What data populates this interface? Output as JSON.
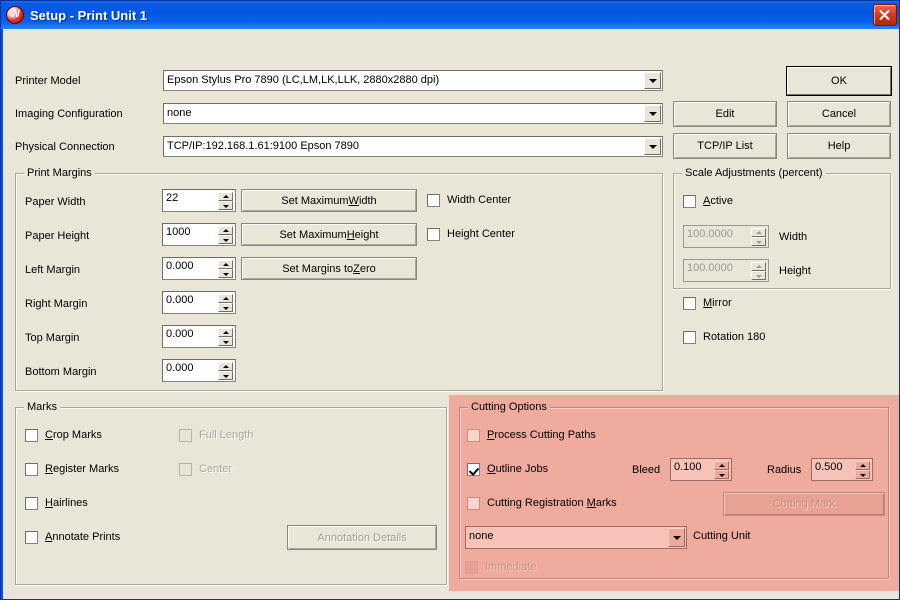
{
  "window": {
    "title": "Setup - Print Unit 1",
    "app_icon": "w-logo-icon",
    "close_label": "×"
  },
  "top_fields": [
    {
      "label": "Printer Model",
      "value": "Epson  Stylus Pro 7890  (LC,LM,LK,LLK, 2880x2880 dpi)"
    },
    {
      "label": "Imaging Configuration",
      "value": "none"
    },
    {
      "label": "Physical Connection",
      "value": "TCP/IP:192.168.1.61:9100 Epson 7890"
    }
  ],
  "side_buttons": {
    "ok": "OK",
    "cancel": "Cancel",
    "help": "Help",
    "edit": "Edit",
    "tcpip_list": "TCP/IP List"
  },
  "print_margins": {
    "title": "Print Margins",
    "rows": [
      {
        "label": "Paper Width",
        "value": "22"
      },
      {
        "label": "Paper Height",
        "value": "1000"
      },
      {
        "label": "Left Margin",
        "value": "0.000"
      },
      {
        "label": "Right Margin",
        "value": "0.000"
      },
      {
        "label": "Top Margin",
        "value": "0.000"
      },
      {
        "label": "Bottom Margin",
        "value": "0.000"
      }
    ],
    "buttons": {
      "set_max_width": {
        "pre": "Set Maximum ",
        "accel": "W",
        "post": "idth"
      },
      "set_max_height": {
        "pre": "Set Maximum ",
        "accel": "H",
        "post": "eight"
      },
      "set_margins_zero": {
        "pre": "Set Margins to ",
        "accel": "Z",
        "post": "ero"
      }
    },
    "checks": [
      {
        "label": "Width Center",
        "checked": false
      },
      {
        "label": "Height Center",
        "checked": false
      }
    ]
  },
  "scale_adjustments": {
    "title": "Scale Adjustments (percent)",
    "active": {
      "pre": "",
      "accel": "A",
      "post": "ctive",
      "checked": false
    },
    "width": {
      "value": "100.0000",
      "label": "Width",
      "disabled": true
    },
    "height": {
      "value": "100.0000",
      "label": "Height",
      "disabled": true
    },
    "mirror": {
      "pre": "",
      "accel": "M",
      "post": "irror",
      "checked": false
    },
    "rotation": {
      "label": "Rotation  180",
      "checked": false
    }
  },
  "marks": {
    "title": "Marks",
    "items": [
      {
        "pre": "",
        "accel": "C",
        "post": "rop Marks",
        "checked": false,
        "disabled": false
      },
      {
        "pre": "",
        "accel": "R",
        "post": "egister Marks",
        "checked": false,
        "disabled": false
      },
      {
        "pre": "",
        "accel": "H",
        "post": "airlines",
        "checked": false,
        "disabled": false
      },
      {
        "pre": "",
        "accel": "A",
        "post": "nnotate Prints",
        "checked": false,
        "disabled": false
      }
    ],
    "sub_items": [
      {
        "label": "Full Length",
        "checked": false,
        "disabled": true
      },
      {
        "label": "Center",
        "checked": false,
        "disabled": true
      }
    ],
    "annotation_button": "Annotation Details"
  },
  "cutting_options": {
    "title": "Cutting Options",
    "panel_color": "#EFAB9D",
    "process_cutting_paths": {
      "pre": "",
      "accel": "P",
      "post": "rocess Cutting Paths",
      "checked": false
    },
    "outline_jobs": {
      "pre": "",
      "accel": "O",
      "post": "utline Jobs",
      "checked": true
    },
    "cutting_registration_marks": {
      "pre": "Cutting Registration ",
      "accel": "M",
      "post": "arks",
      "checked": false
    },
    "bleed": {
      "label": "Bleed",
      "value": "0.100"
    },
    "radius": {
      "label": "Radius",
      "value": "0.500"
    },
    "cutting_mark_button": "Cutting Mark",
    "cutting_unit": {
      "value": "none",
      "label": "Cutting Unit"
    },
    "immediate": {
      "label": "Immediate",
      "checked": false,
      "disabled": true
    }
  }
}
